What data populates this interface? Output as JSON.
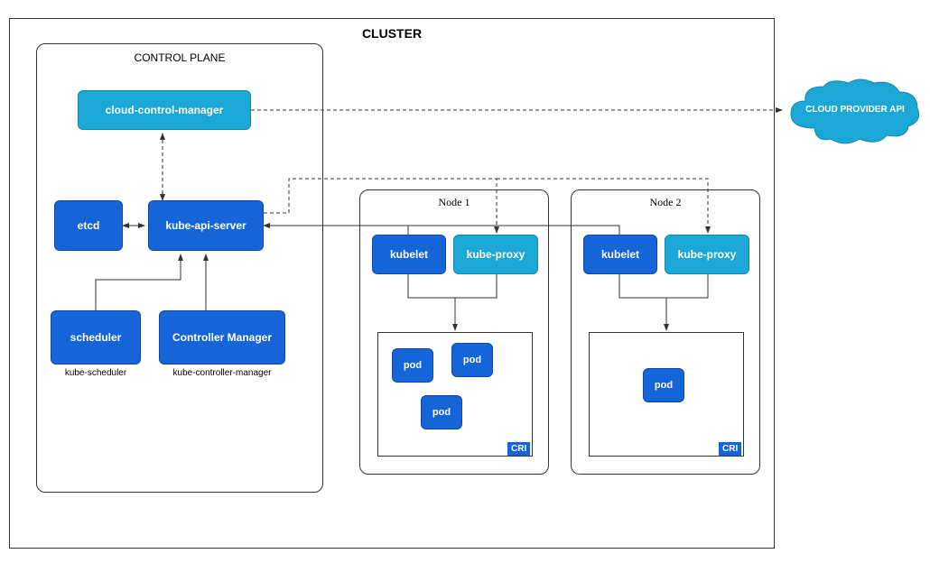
{
  "cluster": {
    "title": "CLUSTER",
    "control_plane": {
      "title": "CONTROL PLANE",
      "cloud_control_manager": "cloud-control-manager",
      "etcd": "etcd",
      "kube_api_server": "kube-api-server",
      "scheduler": "scheduler",
      "scheduler_sub": "kube-scheduler",
      "controller_manager": "Controller Manager",
      "controller_manager_sub": "kube-controller-manager"
    },
    "node1": {
      "title": "Node 1",
      "kubelet": "kubelet",
      "kube_proxy": "kube-proxy",
      "pod1": "pod",
      "pod2": "pod",
      "pod3": "pod",
      "cri": "CRI"
    },
    "node2": {
      "title": "Node 2",
      "kubelet": "kubelet",
      "kube_proxy": "kube-proxy",
      "pod1": "pod",
      "cri": "CRI"
    }
  },
  "cloud_provider": "CLOUD PROVIDER API"
}
